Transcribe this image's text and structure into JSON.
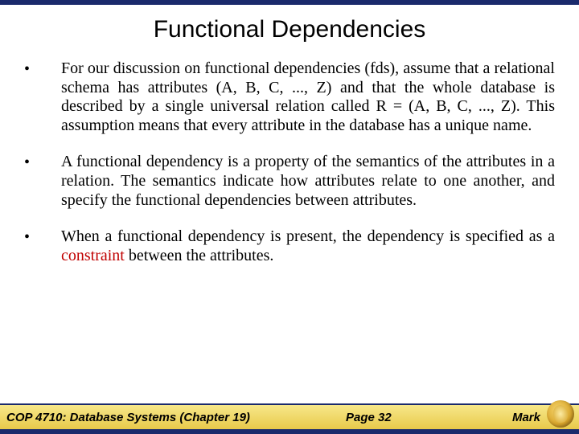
{
  "title": "Functional Dependencies",
  "bullets": [
    {
      "text": "For our discussion on functional dependencies (fds), assume that a relational schema has attributes (A, B, C, ..., Z) and that the whole database is described by a single universal relation called R = (A, B, C, ..., Z).  This assumption means that every attribute in the database has a unique name."
    },
    {
      "text": "A functional dependency is a property of the semantics of the attributes in a relation.  The semantics indicate how attributes relate to one another, and specify the functional dependencies between attributes."
    },
    {
      "prefix": "When a functional dependency is present, the dependency is specified as a ",
      "highlight": "constraint",
      "suffix": " between the attributes."
    }
  ],
  "footer": {
    "course": "COP 4710: Database Systems  (Chapter 19)",
    "page": "Page 32",
    "author": "Mark"
  }
}
